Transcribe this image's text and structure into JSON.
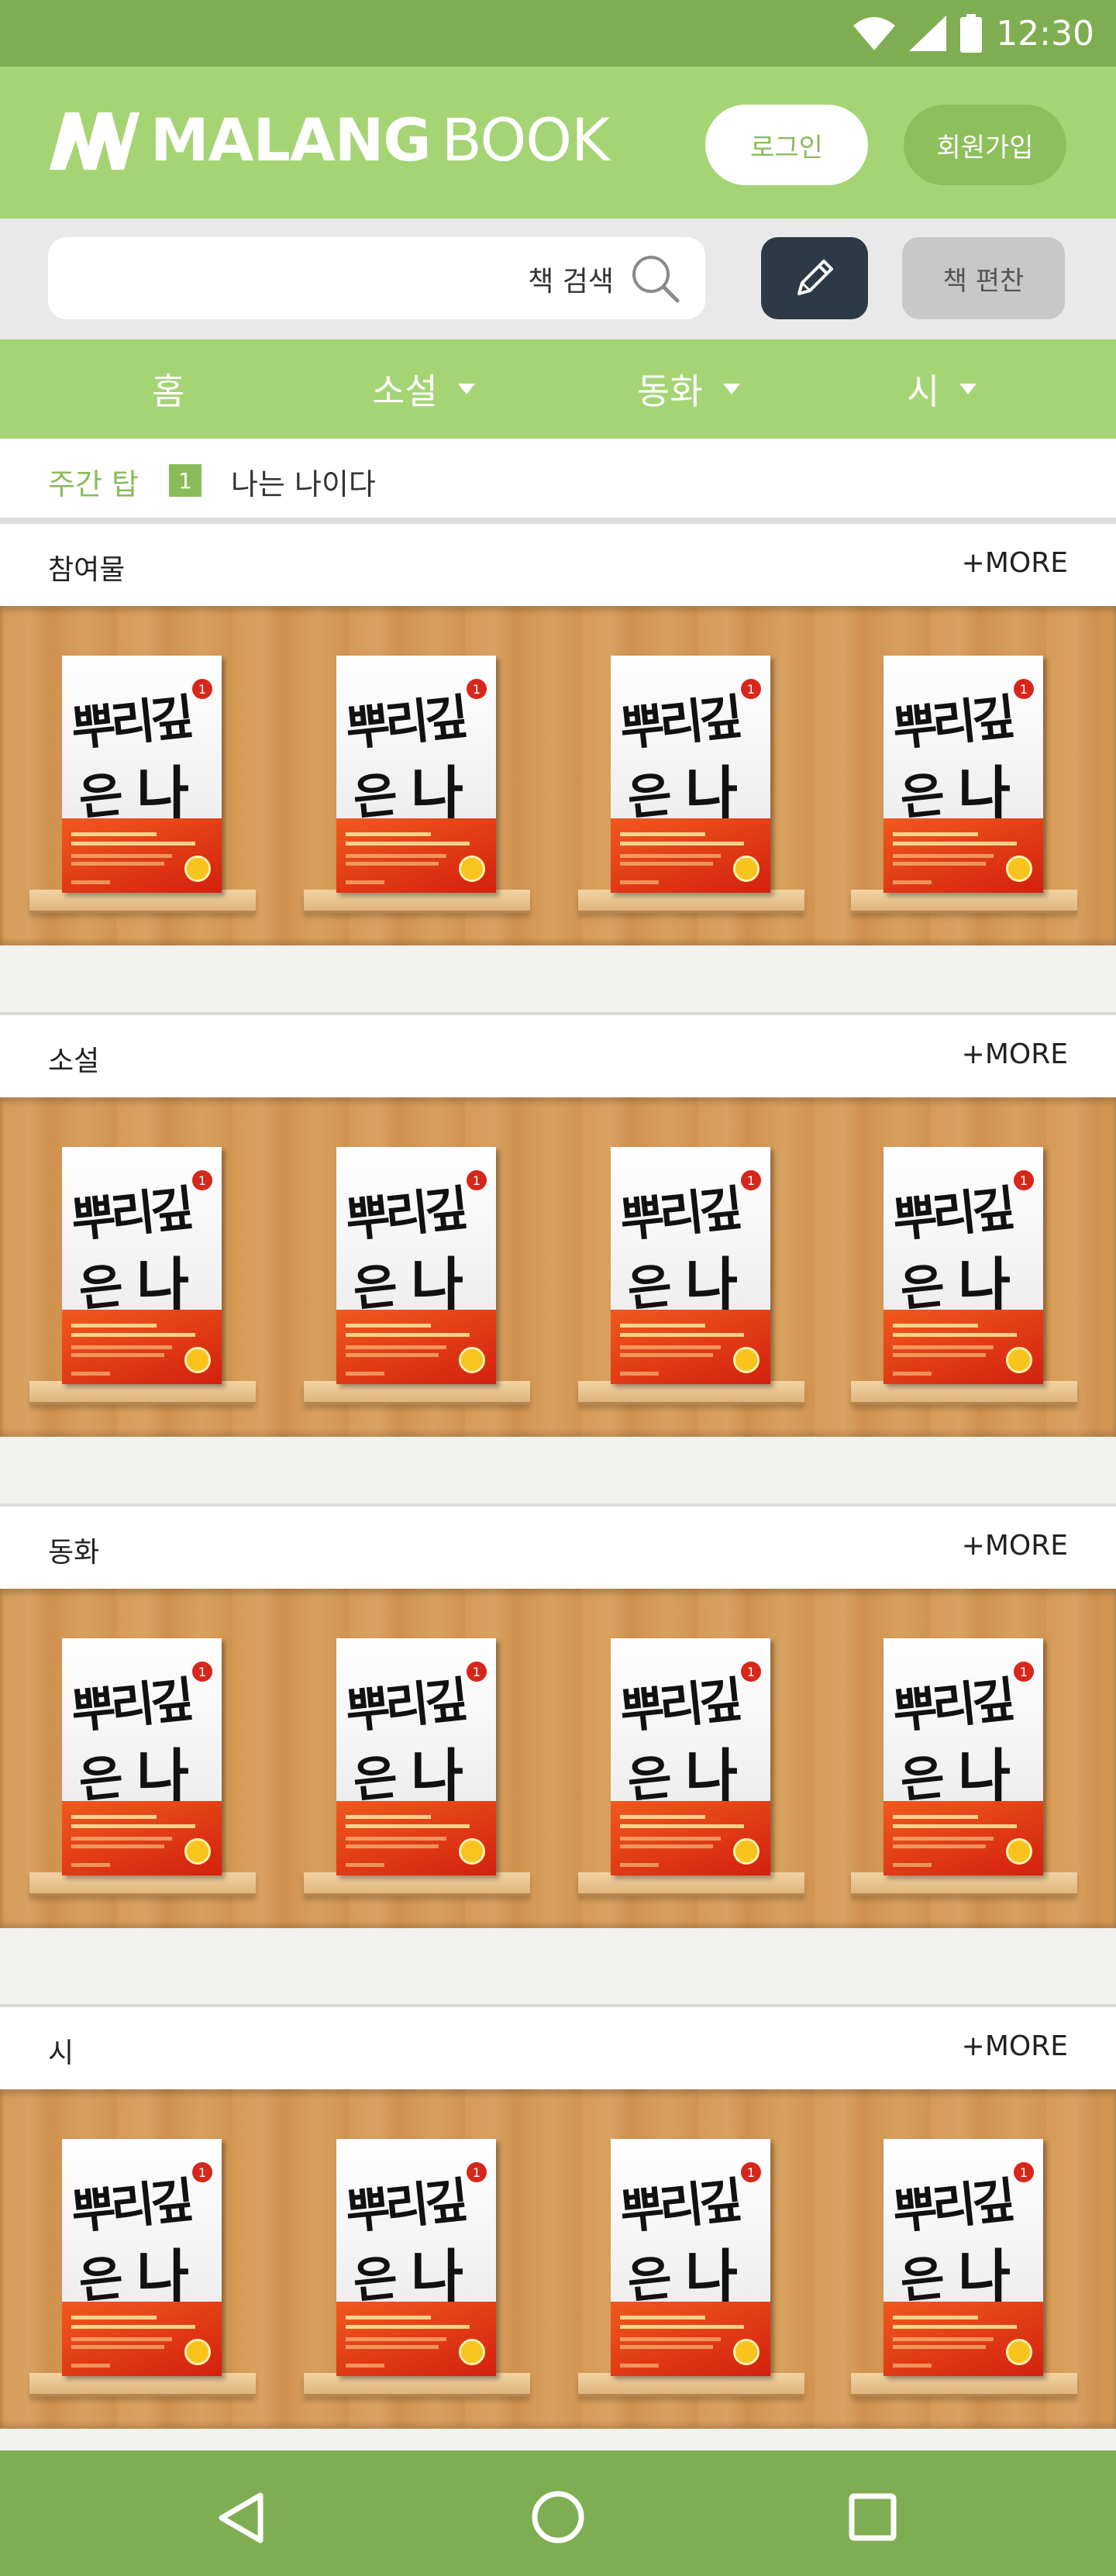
{
  "status_bar": {
    "time": "12:30"
  },
  "header": {
    "brand_bold": "MALANG",
    "brand_thin": "BOOK",
    "login_label": "로그인",
    "signup_label": "회원가입"
  },
  "search": {
    "label": "책 검색",
    "compile_label": "책 편찬"
  },
  "nav": {
    "items": [
      {
        "label": "홈"
      },
      {
        "label": "소설"
      },
      {
        "label": "동화"
      },
      {
        "label": "시"
      }
    ]
  },
  "weekly_top": {
    "label": "주간 탑",
    "rank": "1",
    "title": "나는 나이다"
  },
  "sections": [
    {
      "title": "참여물",
      "more": "+MORE"
    },
    {
      "title": "소설",
      "more": "+MORE"
    },
    {
      "title": "동화",
      "more": "+MORE"
    },
    {
      "title": "시",
      "more": "+MORE"
    }
  ],
  "book": {
    "title_line1": "뿌리깊은",
    "title_line2": "나무",
    "volume": "1"
  },
  "colors": {
    "brand_green": "#a5d474",
    "dark_green": "#7fae52",
    "edit_button": "#2d3a46"
  },
  "icons": {
    "wifi": "wifi-icon",
    "signal": "signal-icon",
    "battery": "battery-icon",
    "search": "search-icon",
    "pencil": "pencil-icon",
    "back": "back-triangle-icon",
    "home": "home-circle-icon",
    "recents": "recents-square-icon"
  }
}
